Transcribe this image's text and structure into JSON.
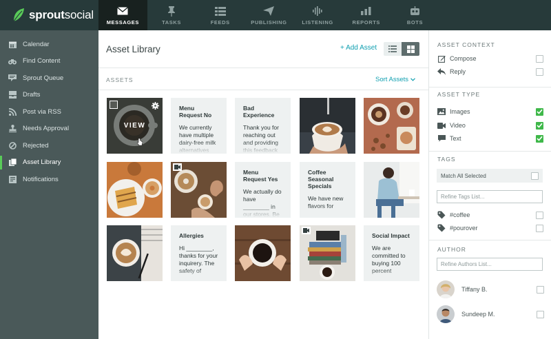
{
  "brand": {
    "name_bold": "sprout",
    "name_rest": "social",
    "accent": "#59cb59"
  },
  "nav": [
    {
      "label": "MESSAGES",
      "icon": "envelope-icon",
      "active": true
    },
    {
      "label": "TASKS",
      "icon": "pin-icon"
    },
    {
      "label": "FEEDS",
      "icon": "feeds-icon"
    },
    {
      "label": "PUBLISHING",
      "icon": "paper-plane-icon"
    },
    {
      "label": "LISTENING",
      "icon": "waveform-icon"
    },
    {
      "label": "REPORTS",
      "icon": "bar-chart-icon"
    },
    {
      "label": "BOTS",
      "icon": "robot-icon"
    }
  ],
  "sidebar": [
    {
      "label": "Calendar",
      "icon": "calendar-icon"
    },
    {
      "label": "Find Content",
      "icon": "binoculars-icon"
    },
    {
      "label": "Sprout Queue",
      "icon": "queue-icon"
    },
    {
      "label": "Drafts",
      "icon": "drafts-icon"
    },
    {
      "label": "Post via RSS",
      "icon": "rss-icon"
    },
    {
      "label": "Needs Approval",
      "icon": "stamp-icon"
    },
    {
      "label": "Rejected",
      "icon": "rejected-icon"
    },
    {
      "label": "Asset Library",
      "icon": "library-icon",
      "active": true
    },
    {
      "label": "Notifications",
      "icon": "notifications-icon"
    }
  ],
  "main": {
    "title": "Asset Library",
    "add_asset": "+ Add Asset",
    "assets_label": "ASSETS",
    "sort_label": "Sort Assets",
    "view_label": "VIEW",
    "view_mode": "grid"
  },
  "tiles": [
    {
      "kind": "photo",
      "scene": "coffee-cup-dark",
      "hovered": true
    },
    {
      "kind": "text",
      "title": "Menu Request No",
      "body": "We currently have multiple dairy-free milk alternatives"
    },
    {
      "kind": "text",
      "title": "Bad Experience",
      "body": "Thank you for reaching out and providing this feedback"
    },
    {
      "kind": "photo",
      "scene": "latte-hand"
    },
    {
      "kind": "photo",
      "scene": "coffee-table-top"
    },
    {
      "kind": "photo",
      "scene": "sandwich-donut"
    },
    {
      "kind": "photo",
      "scene": "donut-share",
      "video": true
    },
    {
      "kind": "text",
      "title": "Menu Request Yes",
      "body": "We actually do have ________ in our stores. Be sure to ask"
    },
    {
      "kind": "text",
      "title": "Coffee Seasonal Specials",
      "body": "We have new flavors for"
    },
    {
      "kind": "photo",
      "scene": "woman-cafe"
    },
    {
      "kind": "photo",
      "scene": "latte-notebook"
    },
    {
      "kind": "text",
      "title": "Allergies",
      "body": "Hi ________, thanks for your inquirery. The safety of"
    },
    {
      "kind": "photo",
      "scene": "cup-hands"
    },
    {
      "kind": "photo",
      "scene": "books-coffee",
      "video": true
    },
    {
      "kind": "text",
      "title": "Social Impact",
      "body": "We are committed to buying 100 percent"
    }
  ],
  "panel": {
    "context_title": "ASSET CONTEXT",
    "context": [
      {
        "label": "Compose",
        "icon": "compose-icon",
        "checked": false
      },
      {
        "label": "Reply",
        "icon": "reply-icon",
        "checked": false
      }
    ],
    "type_title": "ASSET TYPE",
    "types": [
      {
        "label": "Images",
        "icon": "image-icon",
        "checked": true
      },
      {
        "label": "Video",
        "icon": "video-icon",
        "checked": true
      },
      {
        "label": "Text",
        "icon": "text-bubble-icon",
        "checked": true
      }
    ],
    "tags_title": "TAGS",
    "match_all": "Match All Selected",
    "tags_placeholder": "Refine Tags List...",
    "tags": [
      {
        "label": "#coffee",
        "checked": false
      },
      {
        "label": "#pourover",
        "checked": false
      }
    ],
    "author_title": "AUTHOR",
    "authors_placeholder": "Refine Authors List...",
    "authors": [
      {
        "name": "Tiffany B.",
        "checked": false
      },
      {
        "name": "Sundeep M.",
        "checked": false
      }
    ]
  }
}
